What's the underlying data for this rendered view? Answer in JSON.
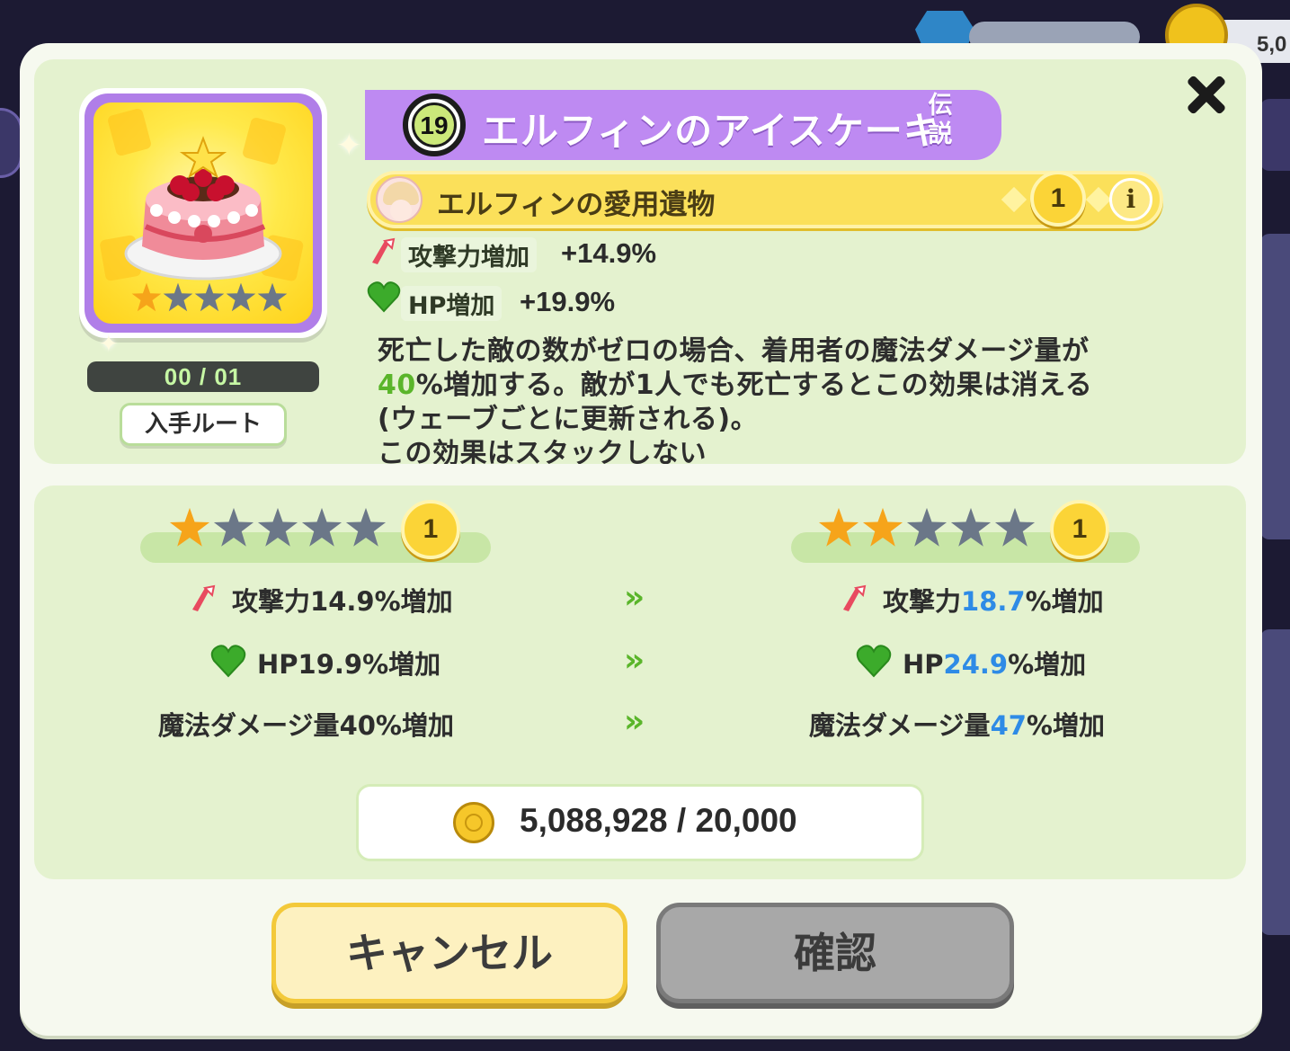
{
  "header": {
    "coin_balance_partial": "5,0"
  },
  "item": {
    "level": "19",
    "name": "エルフィンのアイスケーキ",
    "rarity": "伝説",
    "star_rating": 1,
    "star_max": 5,
    "count": "00 / 01",
    "route_label": "入手ルート"
  },
  "relic": {
    "title": "エルフィンの愛用遺物",
    "level": "1",
    "info_label": "i"
  },
  "stats": {
    "attack_label": "攻撃力増加",
    "attack_value": "+14.9%",
    "hp_label": "HP増加",
    "hp_value": "+19.9%"
  },
  "description": {
    "line1": "死亡した敵の数がゼロの場合、着用者の魔法ダメージ量が",
    "line2_highlight": "40",
    "line2_rest": "%増加する。敵が1人でも死亡するとこの効果は消える",
    "line3": "(ウェーブごとに更新される)。",
    "line4": "この効果はスタックしない"
  },
  "upgrade": {
    "current": {
      "stars": 1,
      "level": "1",
      "attack_prefix": "攻撃力",
      "attack_value": "14.9",
      "attack_suffix": "%増加",
      "hp_prefix": "HP",
      "hp_value": "19.9",
      "hp_suffix": "%増加",
      "magic_prefix": "魔法ダメージ量",
      "magic_value": "40",
      "magic_suffix": "%増加"
    },
    "next": {
      "stars": 2,
      "level": "1",
      "attack_prefix": "攻撃力",
      "attack_value": "18.7",
      "attack_suffix": "%増加",
      "hp_prefix": "HP",
      "hp_value": "24.9",
      "hp_suffix": "%増加",
      "magic_prefix": "魔法ダメージ量",
      "magic_value": "47",
      "magic_suffix": "%増加"
    },
    "arrow": "»"
  },
  "cost": {
    "text": "5,088,928 / 20,000"
  },
  "buttons": {
    "cancel": "キャンセル",
    "confirm": "確認"
  },
  "colors": {
    "accent_purple": "#be8af2",
    "relic_yellow": "#fbe05a",
    "highlight_green": "#5ab52a",
    "highlight_blue": "#2e8be6"
  }
}
